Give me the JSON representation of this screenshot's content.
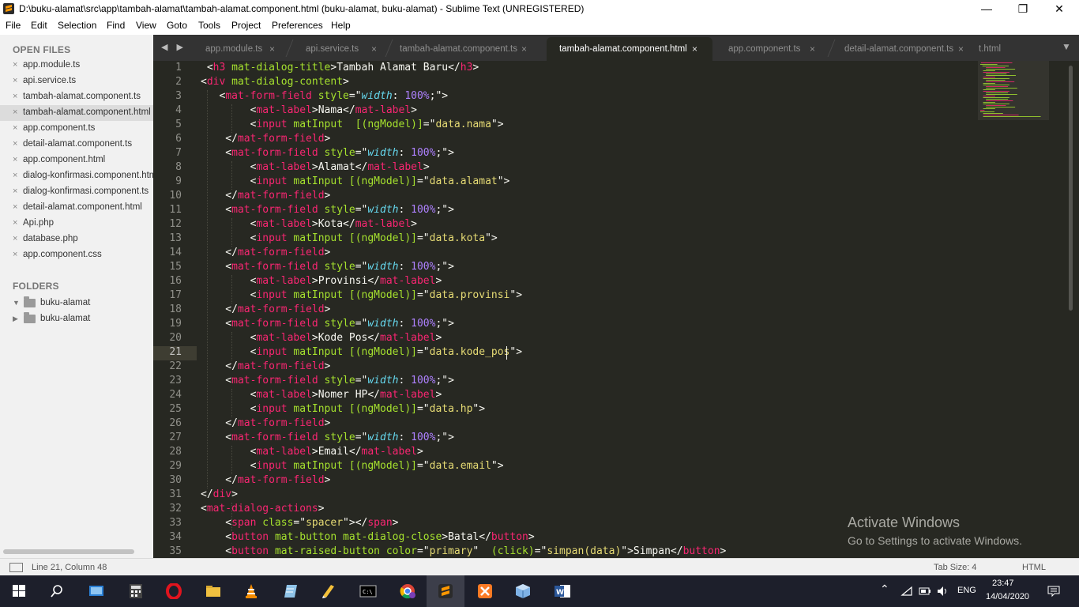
{
  "window": {
    "title": "D:\\buku-alamat\\src\\app\\tambah-alamat\\tambah-alamat.component.html (buku-alamat, buku-alamat) - Sublime Text (UNREGISTERED)",
    "minimize": "—",
    "maximize": "❐",
    "close": "✕"
  },
  "menu": [
    "File",
    "Edit",
    "Selection",
    "Find",
    "View",
    "Goto",
    "Tools",
    "Project",
    "Preferences",
    "Help"
  ],
  "sidebar": {
    "open_files_header": "OPEN FILES",
    "close_glyph": "×",
    "open_files": [
      "app.module.ts",
      "api.service.ts",
      "tambah-alamat.component.ts",
      "tambah-alamat.component.html",
      "app.component.ts",
      "detail-alamat.component.ts",
      "app.component.html",
      "dialog-konfirmasi.component.html",
      "dialog-konfirmasi.component.ts",
      "detail-alamat.component.html",
      "Api.php",
      "database.php",
      "app.component.css"
    ],
    "active_index": 3,
    "folders_header": "FOLDERS",
    "folders": [
      {
        "name": "buku-alamat",
        "expanded": true
      },
      {
        "name": "buku-alamat",
        "expanded": false
      }
    ]
  },
  "tabs": {
    "nav": "◀ ▶",
    "dropdown": "▼",
    "close_glyph": "×",
    "items": [
      {
        "label": "app.module.ts",
        "active": false
      },
      {
        "label": "api.service.ts",
        "active": false
      },
      {
        "label": "tambah-alamat.component.ts",
        "active": false
      },
      {
        "label": "tambah-alamat.component.html",
        "active": true
      },
      {
        "label": "app.component.ts",
        "active": false
      },
      {
        "label": "detail-alamat.component.ts",
        "active": false
      },
      {
        "label": "t.html",
        "active": false
      }
    ]
  },
  "editor": {
    "current_line": 21,
    "line_numbers": [
      "1",
      "2",
      "3",
      "4",
      "5",
      "6",
      "7",
      "8",
      "9",
      "10",
      "11",
      "12",
      "13",
      "14",
      "15",
      "16",
      "17",
      "18",
      "19",
      "20",
      "21",
      "22",
      "23",
      "24",
      "25",
      "26",
      "27",
      "28",
      "29",
      "30",
      "31",
      "32",
      "33",
      "34",
      "35"
    ],
    "lines": [
      " <h3 mat-dialog-title>Tambah Alamat Baru</h3>",
      "<div mat-dialog-content>",
      "   <mat-form-field style=\"width: 100%;\">",
      "        <mat-label>Nama</mat-label>",
      "        <input matInput  [(ngModel)]=\"data.nama\">",
      "    </mat-form-field>",
      "    <mat-form-field style=\"width: 100%;\">",
      "        <mat-label>Alamat</mat-label>",
      "        <input matInput [(ngModel)]=\"data.alamat\">",
      "    </mat-form-field>",
      "    <mat-form-field style=\"width: 100%;\">",
      "        <mat-label>Kota</mat-label>",
      "        <input matInput [(ngModel)]=\"data.kota\">",
      "    </mat-form-field>",
      "    <mat-form-field style=\"width: 100%;\">",
      "        <mat-label>Provinsi</mat-label>",
      "        <input matInput [(ngModel)]=\"data.provinsi\">",
      "    </mat-form-field>",
      "    <mat-form-field style=\"width: 100%;\">",
      "        <mat-label>Kode Pos</mat-label>",
      "        <input matInput [(ngModel)]=\"data.kode_pos\">",
      "    </mat-form-field>",
      "    <mat-form-field style=\"width: 100%;\">",
      "        <mat-label>Nomer HP</mat-label>",
      "        <input matInput [(ngModel)]=\"data.hp\">",
      "    </mat-form-field>",
      "    <mat-form-field style=\"width: 100%;\">",
      "        <mat-label>Email</mat-label>",
      "        <input matInput [(ngModel)]=\"data.email\">",
      "    </mat-form-field>",
      "</div>",
      "<mat-dialog-actions>",
      "    <span class=\"spacer\"></span>",
      "    <button mat-button mat-dialog-close>Batal</button>",
      "    <button mat-raised-button color=\"primary\"  (click)=\"simpan(data)\">Simpan</button>"
    ],
    "colors": {
      "background": "#272822",
      "tag": "#f92672",
      "attribute": "#a6e22e",
      "string": "#e6db74",
      "property": "#66d9ef",
      "number": "#ae81ff",
      "text": "#f8f8f2"
    }
  },
  "watermark": {
    "line1": "Activate Windows",
    "line2": "Go to Settings to activate Windows."
  },
  "statusbar": {
    "position": "Line 21, Column 48",
    "tab_size": "Tab Size: 4",
    "syntax": "HTML"
  },
  "taskbar": {
    "apps": [
      "windows-start",
      "search",
      "desktop-app",
      "calculator",
      "opera",
      "file-explorer",
      "vlc",
      "notepad",
      "sublime-merge",
      "terminal",
      "chrome",
      "sublime-text",
      "xampp",
      "virtualbox",
      "word"
    ],
    "active_app": "sublime-text",
    "tray": {
      "language": "ENG",
      "time": "23:47",
      "date": "14/04/2020"
    }
  }
}
